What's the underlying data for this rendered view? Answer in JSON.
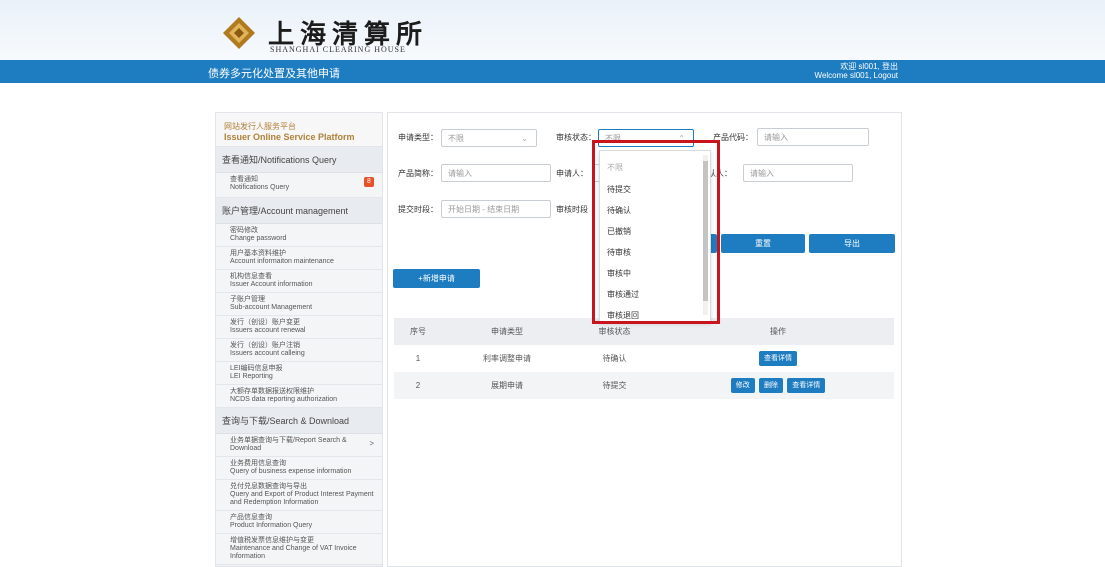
{
  "header": {
    "logo_cn": "上海清算所",
    "logo_en": "SHANGHAI CLEARING HOUSE",
    "page_title": "债券多元化处置及其他申请",
    "user_line1": "欢迎 sl001, 登出",
    "user_line2": "Welcome sl001, Logout"
  },
  "sidebar": {
    "platform_cn": "网站发行人服务平台",
    "platform_en": "Issuer Online Service Platform",
    "sections": [
      {
        "title": "查看通知/Notifications Query",
        "items": [
          {
            "cn": "查看通知",
            "en": "Notifications Query",
            "badge": "8"
          }
        ]
      },
      {
        "title": "账户管理/Account management",
        "items": [
          {
            "cn": "密码修改",
            "en": "Change password"
          },
          {
            "cn": "用户基本资料维护",
            "en": "Account informaiton maintenance"
          },
          {
            "cn": "机构信息查看",
            "en": "Issuer Account information"
          },
          {
            "cn": "子账户管理",
            "en": "Sub-account Management"
          },
          {
            "cn": "发行（创设）账户变更",
            "en": "Issuers account renewal"
          },
          {
            "cn": "发行（创设）账户注销",
            "en": "Issuers account calleing"
          },
          {
            "cn": "LEI编码信息申报",
            "en": "LEI Reporting"
          },
          {
            "cn": "大额存单数据报送权限维护",
            "en": "NCDS data reporting authorization"
          }
        ]
      },
      {
        "title": "查询与下载/Search & Download",
        "items": [
          {
            "cn": "业务单据查询与下载/Report Search &",
            "en": "Download",
            "arrow": ">"
          },
          {
            "cn": "业务费用信息查询",
            "en": "Query of business expense information"
          },
          {
            "cn": "兑付兑息数据查询与导出",
            "en": "Query and Export of Product Interest Payment and Redemption Information"
          },
          {
            "cn": "产品信息查询",
            "en": "Product Information Query"
          },
          {
            "cn": "增值税发票信息维护与变更",
            "en": "Maintenance and Change of VAT Invoice Information"
          }
        ]
      }
    ]
  },
  "filters": {
    "apply_type_label": "申请类型：",
    "apply_type_value": "不限",
    "review_status_label": "审核状态：",
    "review_status_value": "不限",
    "product_code_label": "产品代码：",
    "product_code_placeholder": "请输入",
    "product_short_label": "产品简称：",
    "product_short_placeholder": "请输入",
    "applicant_label": "申请人：",
    "confirmer_label": "确认人：",
    "confirmer_placeholder": "请输入",
    "submit_time_label": "提交时段：",
    "submit_time_placeholder": "开始日期 - 结束日期",
    "review_time_label": "审核时段"
  },
  "buttons": {
    "reset": "重置",
    "export": "导出",
    "new_apply": "+新增申请",
    "edit": "修改",
    "delete": "删除",
    "view": "查看详情"
  },
  "dropdown": {
    "options": [
      "不限",
      "待提交",
      "待确认",
      "已撤销",
      "待审核",
      "审核中",
      "审核通过",
      "审核退回"
    ]
  },
  "table": {
    "headers": [
      "序号",
      "申请类型",
      "审核状态",
      "",
      "操作"
    ],
    "rows": [
      {
        "no": "1",
        "type": "利率调整申请",
        "status": "待确认"
      },
      {
        "no": "2",
        "type": "展期申请",
        "status": "待提交"
      }
    ]
  }
}
